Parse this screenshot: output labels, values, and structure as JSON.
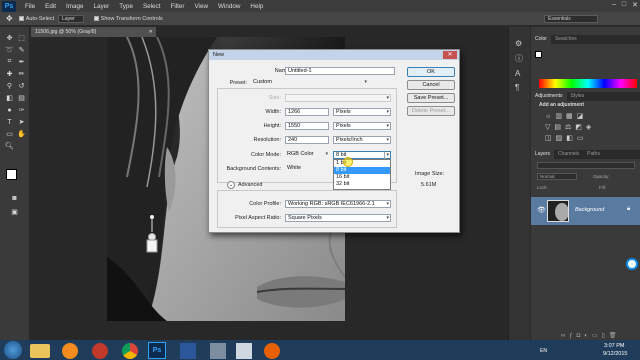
{
  "menubar": {
    "logo": "Ps",
    "items": [
      "File",
      "Edit",
      "Image",
      "Layer",
      "Type",
      "Select",
      "Filter",
      "View",
      "Window",
      "Help"
    ],
    "window_controls": [
      "–",
      "□",
      "✕"
    ]
  },
  "options": {
    "auto_select_label": "Auto-Select",
    "layer_dropdown": "Layer",
    "show_transform_label": "Show Transform Controls",
    "workspace": "Essentials"
  },
  "document": {
    "tab_title": "11506.jpg @ 50% (Gray/8)",
    "zoom": "50%",
    "doc_size": "Doc: 1.05M/1.05M"
  },
  "bottom_tabs": [
    "Mini Bridge",
    "Timeline"
  ],
  "panels": {
    "color_tabs": [
      "Color",
      "Swatches"
    ],
    "adjust_tabs": [
      "Adjustments",
      "Styles"
    ],
    "adjust_title": "Add an adjustment",
    "layers_tabs": [
      "Layers",
      "Channels",
      "Paths"
    ],
    "layer_mode": "Normal",
    "opacity_label": "Opacity:",
    "fill_label": "Fill:",
    "lock_label": "Lock:",
    "layer_name": "Background"
  },
  "dialog": {
    "title": "New",
    "name_label": "Name:",
    "name_value": "Untitled-1",
    "preset_label": "Preset:",
    "preset_value": "Custom",
    "size_label": "Size:",
    "width_label": "Width:",
    "width_value": "1266",
    "width_unit": "Pixels",
    "height_label": "Height:",
    "height_value": "1550",
    "height_unit": "Pixels",
    "resolution_label": "Resolution:",
    "resolution_value": "240",
    "resolution_unit": "Pixels/Inch",
    "color_mode_label": "Color Mode:",
    "color_mode_value": "RGB Color",
    "bit_depth_value": "8 bit",
    "bit_options": [
      "1 bit",
      "8 bit",
      "16 bit",
      "32 bit"
    ],
    "bg_contents_label": "Background Contents:",
    "bg_contents_value": "White",
    "advanced_label": "Advanced",
    "color_profile_label": "Color Profile:",
    "color_profile_value": "Working RGB: sRGB IEC61966-2.1",
    "pixel_aspect_label": "Pixel Aspect Ratio:",
    "pixel_aspect_value": "Square Pixels",
    "ok": "OK",
    "cancel": "Cancel",
    "save_preset": "Save Preset...",
    "delete_preset": "Delete Preset...",
    "image_size_label": "Image Size:",
    "image_size_value": "5.61M"
  },
  "taskbar": {
    "lang": "EN",
    "time": "3:07 PM",
    "date": "9/12/2015"
  },
  "colors": {
    "accent_select": "#3399ff",
    "ps_blue": "#2fa3f7",
    "taskbar": "#1f3d5a"
  }
}
